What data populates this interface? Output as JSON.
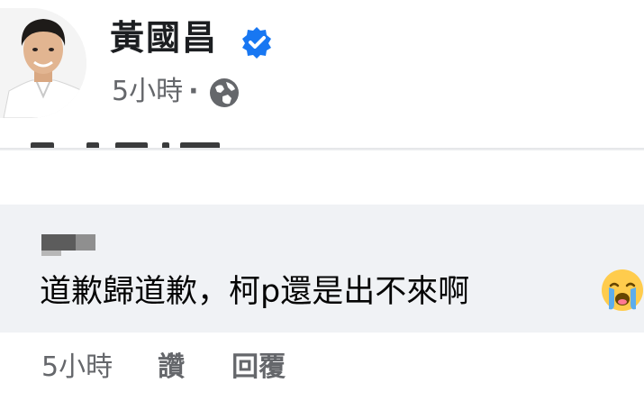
{
  "post": {
    "author_name": "黃國昌",
    "timestamp": "5小時",
    "separator": "·",
    "privacy_icon": "globe-icon",
    "verified_icon": "verified-badge-icon"
  },
  "comment": {
    "text": "道歉歸道歉，柯p還是出不來啊",
    "emoji": "loudly-crying-face-icon",
    "timestamp": "5小時",
    "like_label": "讚",
    "reply_label": "回覆"
  },
  "colors": {
    "verified_blue": "#1877f2",
    "bubble_bg": "#f0f2f5",
    "secondary_text": "#65676b"
  }
}
